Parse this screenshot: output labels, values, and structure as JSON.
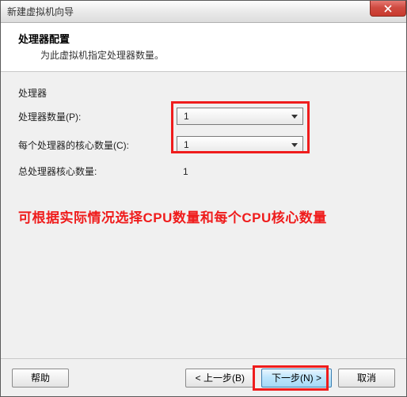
{
  "window": {
    "title": "新建虚拟机向导"
  },
  "header": {
    "title": "处理器配置",
    "subtitle": "为此虚拟机指定处理器数量。"
  },
  "form": {
    "section_label": "处理器",
    "processors_label": "处理器数量(P):",
    "processors_value": "1",
    "cores_label": "每个处理器的核心数量(C):",
    "cores_value": "1",
    "total_label": "总处理器核心数量:",
    "total_value": "1"
  },
  "annotation": "可根据实际情况选择CPU数量和每个CPU核心数量",
  "footer": {
    "help": "帮助",
    "back": "< 上一步(B)",
    "next": "下一步(N) >",
    "cancel": "取消"
  }
}
